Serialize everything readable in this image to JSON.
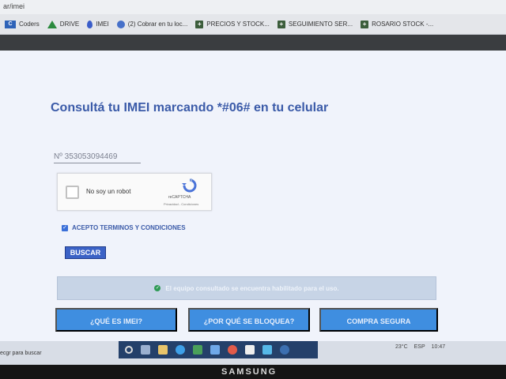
{
  "browser": {
    "url": "ar/imei",
    "bookmarks": [
      {
        "label": "Coders",
        "icon": "coders-icon"
      },
      {
        "label": "DRIVE",
        "icon": "drive-icon"
      },
      {
        "label": "IMEI",
        "icon": "imei-icon"
      },
      {
        "label": "(2) Cobrar en tu loc...",
        "icon": "mercadopago-icon"
      },
      {
        "label": "PRECIOS Y STOCK...",
        "icon": "sheets-icon"
      },
      {
        "label": "SEGUIMIENTO SER...",
        "icon": "sheets-icon"
      },
      {
        "label": "ROSARIO STOCK -...",
        "icon": "sheets-icon"
      }
    ]
  },
  "page": {
    "title": "Consultá tu IMEI marcando *#06# en tu celular",
    "imei_label": "Nº",
    "imei_value": "353053094469",
    "captcha": {
      "label": "No soy un robot",
      "brand": "reCAPTCHA",
      "privacy": "Privacidad - Condiciones"
    },
    "terms_label": "ACEPTO TERMINOS Y CONDICIONES",
    "search_button": "BUSCAR",
    "status_message": "El equipo consultado se encuentra habilitado para el uso.",
    "cta_buttons": [
      {
        "label": "¿QUÉ ES IMEI?"
      },
      {
        "label": "¿POR QUÉ SE BLOQUEA?"
      },
      {
        "label": "COMPRA SEGURA"
      }
    ]
  },
  "taskbar": {
    "search_placeholder": "ecgr para buscar",
    "temperature": "23°C",
    "time": "10:47",
    "language": "ESP"
  },
  "monitor": {
    "brand": "SAMSUNG"
  },
  "colors": {
    "primary": "#3a5aa8",
    "button_blue": "#3f8ee0",
    "status_bg": "#c7d4e6",
    "success": "#2e9a55"
  }
}
